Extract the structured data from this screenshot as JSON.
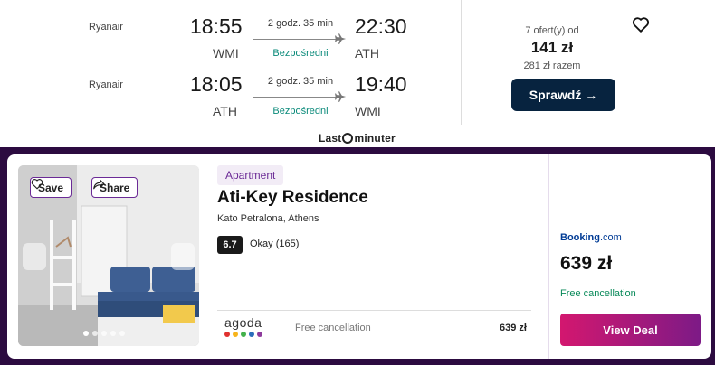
{
  "flight": {
    "legs": [
      {
        "airline": "Ryanair",
        "dep_time": "18:55",
        "dep_code": "WMI",
        "duration": "2 godz. 35 min",
        "stops": "Bezpośredni",
        "arr_time": "22:30",
        "arr_code": "ATH"
      },
      {
        "airline": "Ryanair",
        "dep_time": "18:05",
        "dep_code": "ATH",
        "duration": "2 godz. 35 min",
        "stops": "Bezpośredni",
        "arr_time": "19:40",
        "arr_code": "WMI"
      }
    ],
    "offers_label": "7 ofert(y) od",
    "price": "141 zł",
    "total": "281 zł razem",
    "cta": "Sprawdź →",
    "provider_logo": {
      "part1": "Last",
      "part2": "minuter"
    },
    "icons": {
      "favorite": "heart-icon",
      "route": "airplane-icon"
    },
    "colors": {
      "cta_bg": "#07233f",
      "direct": "#0a8a7a"
    }
  },
  "hotel": {
    "photo_actions": {
      "save": "Save",
      "share": "Share"
    },
    "type": "Apartment",
    "name": "Ati-Key Residence",
    "location": "Kato Petralona, Athens",
    "score": "6.7",
    "rating_text": "Okay (165)",
    "photo_count": 5,
    "active_photo": 0,
    "provider": {
      "name": "agoda",
      "cancellation": "Free cancellation",
      "price": "639 zł",
      "dot_colors": [
        "#e0312f",
        "#f7b41b",
        "#43b14b",
        "#2a6ebb",
        "#8e3a9c"
      ]
    },
    "deal": {
      "provider_name": "Booking",
      "provider_suffix": ".com",
      "price": "639 zł",
      "cancellation": "Free cancellation",
      "cta": "View Deal"
    },
    "colors": {
      "band": "#2c0b40",
      "accent": "#6b2a96",
      "cta_start": "#d3176f",
      "cta_end": "#7d1a86"
    }
  }
}
